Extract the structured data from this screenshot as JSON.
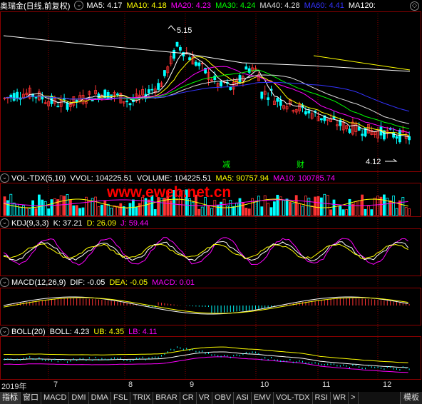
{
  "header": {
    "title": "奥瑞金(日线,前复权)",
    "ma_items": [
      {
        "label": "MA5: 4.17",
        "color": "#ffffff"
      },
      {
        "label": "MA10: 4.18",
        "color": "#ffff00"
      },
      {
        "label": "MA20: 4.23",
        "color": "#ff00ff"
      },
      {
        "label": "MA30: 4.24",
        "color": "#00ff00"
      },
      {
        "label": "MA40: 4.28",
        "color": "#dddddd"
      },
      {
        "label": "MA60: 4.41",
        "color": "#3333ff"
      },
      {
        "label": "MA120:",
        "color": "#ffffff"
      }
    ]
  },
  "volume_header": {
    "items": [
      {
        "label": "VOL-TDX(5,10)",
        "color": "#ffffff"
      },
      {
        "label": "VVOL: 104225.51",
        "color": "#ffffff"
      },
      {
        "label": "VOLUME: 104225.51",
        "color": "#ffffff"
      },
      {
        "label": "MA5: 90757.94",
        "color": "#ffff00"
      },
      {
        "label": "MA10: 100785.74",
        "color": "#ff00ff"
      }
    ]
  },
  "kdj_header": {
    "items": [
      {
        "label": "KDJ(9,3,3)",
        "color": "#ffffff"
      },
      {
        "label": "K: 37.21",
        "color": "#ffffff"
      },
      {
        "label": "D: 26.09",
        "color": "#ffff00"
      },
      {
        "label": "J: 59.44",
        "color": "#ff00ff"
      }
    ]
  },
  "macd_header": {
    "items": [
      {
        "label": "MACD(12,26,9)",
        "color": "#ffffff"
      },
      {
        "label": "DIF: -0.05",
        "color": "#ffffff"
      },
      {
        "label": "DEA: -0.05",
        "color": "#ffff00"
      },
      {
        "label": "MACD: 0.01",
        "color": "#ff00ff"
      }
    ]
  },
  "boll_header": {
    "items": [
      {
        "label": "BOLL(20)",
        "color": "#ffffff"
      },
      {
        "label": "BOLL: 4.23",
        "color": "#ffffff"
      },
      {
        "label": "UB: 4.35",
        "color": "#ffff00"
      },
      {
        "label": "LB: 4.11",
        "color": "#ff00ff"
      }
    ]
  },
  "watermark": "www.eweb.net.cn",
  "annotations": {
    "high": "5.15",
    "low": "4.12",
    "marker1": "减",
    "marker2": "财"
  },
  "x_axis": {
    "labels": [
      "2019年",
      "7",
      "8",
      "9",
      "10",
      "11",
      "12"
    ]
  },
  "tabs": [
    "指标",
    "窗口",
    "MACD",
    "DMI",
    "DMA",
    "FSL",
    "TRIX",
    "BRAR",
    "CR",
    "VR",
    "OBV",
    "ASI",
    "EMV",
    "VOL-TDX",
    "RSI",
    "WR",
    ">"
  ],
  "template_button": "模板",
  "chart_data": {
    "type": "candlestick",
    "title": "奥瑞金(日线,前复权)",
    "high_label": 5.15,
    "low_label": 4.12,
    "last": {
      "MA5": 4.17,
      "MA10": 4.18,
      "MA20": 4.23,
      "MA30": 4.24,
      "MA40": 4.28,
      "MA60": 4.41
    },
    "volume_last": {
      "VVOL": 104225.51,
      "VOLUME": 104225.51,
      "MA5": 90757.94,
      "MA10": 100785.74
    },
    "kdj_last": {
      "K": 37.21,
      "D": 26.09,
      "J": 59.44
    },
    "macd_last": {
      "DIF": -0.05,
      "DEA": -0.05,
      "MACD": 0.01
    },
    "boll_last": {
      "BOLL": 4.23,
      "UB": 4.35,
      "LB": 4.11
    }
  }
}
